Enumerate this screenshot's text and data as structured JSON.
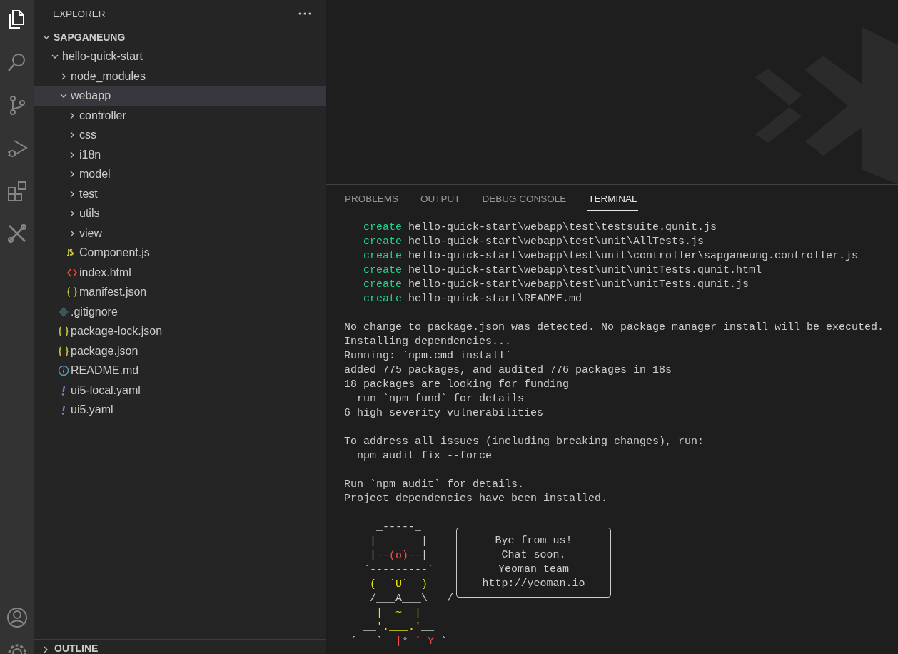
{
  "activity_bar": {
    "items": [
      {
        "kind": "files",
        "selected": true
      },
      {
        "kind": "search",
        "selected": false
      },
      {
        "kind": "source-control",
        "selected": false
      },
      {
        "kind": "run-debug",
        "selected": false
      },
      {
        "kind": "extensions",
        "selected": false
      },
      {
        "kind": "tools",
        "selected": false
      }
    ],
    "bottom_items": [
      {
        "kind": "account",
        "selected": false
      },
      {
        "kind": "settings",
        "selected": false
      }
    ]
  },
  "sidebar": {
    "title": "EXPLORER",
    "tree": {
      "label": "SAPGANEUNG",
      "kind": "folder",
      "expanded": true,
      "selected": false,
      "children": [
        {
          "label": "hello-quick-start",
          "kind": "folder",
          "expanded": true,
          "selected": false,
          "children": [
            {
              "label": "node_modules",
              "kind": "folder",
              "expanded": false,
              "selected": false
            },
            {
              "label": "webapp",
              "kind": "folder",
              "expanded": true,
              "selected": true,
              "children": [
                {
                  "label": "controller",
                  "kind": "folder",
                  "expanded": false,
                  "selected": false
                },
                {
                  "label": "css",
                  "kind": "folder",
                  "expanded": false,
                  "selected": false
                },
                {
                  "label": "i18n",
                  "kind": "folder",
                  "expanded": false,
                  "selected": false
                },
                {
                  "label": "model",
                  "kind": "folder",
                  "expanded": false,
                  "selected": false
                },
                {
                  "label": "test",
                  "kind": "folder",
                  "expanded": false,
                  "selected": false
                },
                {
                  "label": "utils",
                  "kind": "folder",
                  "expanded": false,
                  "selected": false
                },
                {
                  "label": "view",
                  "kind": "folder",
                  "expanded": false,
                  "selected": false
                },
                {
                  "label": "Component.js",
                  "kind": "js",
                  "selected": false
                },
                {
                  "label": "index.html",
                  "kind": "html",
                  "selected": false
                },
                {
                  "label": "manifest.json",
                  "kind": "json",
                  "selected": false
                }
              ]
            },
            {
              "label": ".gitignore",
              "kind": "git",
              "selected": false
            },
            {
              "label": "package-lock.json",
              "kind": "json",
              "selected": false
            },
            {
              "label": "package.json",
              "kind": "json",
              "selected": false
            },
            {
              "label": "README.md",
              "kind": "info",
              "selected": false
            },
            {
              "label": "ui5-local.yaml",
              "kind": "yaml",
              "selected": false
            },
            {
              "label": "ui5.yaml",
              "kind": "yaml",
              "selected": false
            }
          ]
        }
      ]
    },
    "outline": {
      "label": "OUTLINE",
      "expanded": false
    }
  },
  "panel": {
    "tabs": [
      {
        "label": "PROBLEMS",
        "selected": false
      },
      {
        "label": "OUTPUT",
        "selected": false
      },
      {
        "label": "DEBUG CONSOLE",
        "selected": false
      },
      {
        "label": "TERMINAL",
        "selected": true
      }
    ],
    "terminal": {
      "groups": [
        [
          [
            {
              "text": "   create",
              "color": "#23d18b"
            },
            {
              "text": " hello-quick-start\\webapp\\test\\testsuite.qunit.js"
            }
          ],
          [
            {
              "text": "   create",
              "color": "#23d18b"
            },
            {
              "text": " hello-quick-start\\webapp\\test\\unit\\AllTests.js"
            }
          ],
          [
            {
              "text": "   create",
              "color": "#23d18b"
            },
            {
              "text": " hello-quick-start\\webapp\\test\\unit\\controller\\sapganeung.controller.js"
            }
          ],
          [
            {
              "text": "   create",
              "color": "#23d18b"
            },
            {
              "text": " hello-quick-start\\webapp\\test\\unit\\unitTests.qunit.html"
            }
          ],
          [
            {
              "text": "   create",
              "color": "#23d18b"
            },
            {
              "text": " hello-quick-start\\webapp\\test\\unit\\unitTests.qunit.js"
            }
          ],
          [
            {
              "text": "   create",
              "color": "#23d18b"
            },
            {
              "text": " hello-quick-start\\README.md"
            }
          ]
        ],
        [
          [
            {
              "text": "No change to package.json was detected. No package manager install will be executed."
            }
          ],
          [
            {
              "text": "Installing dependencies..."
            }
          ],
          [
            {
              "text": "Running: `npm.cmd install`"
            }
          ],
          [
            {
              "text": "added 775 packages, and audited 776 packages in 18s"
            }
          ],
          [
            {
              "text": "18 packages are looking for funding"
            }
          ],
          [
            {
              "text": "  run `npm fund` for details"
            }
          ],
          [
            {
              "text": "6 high severity vulnerabilities"
            }
          ]
        ],
        [
          [
            {
              "text": "To address all issues (including breaking changes), run:"
            }
          ],
          [
            {
              "text": "  npm audit fix --force"
            }
          ]
        ],
        [
          [
            {
              "text": "Run `npm audit` for details."
            }
          ],
          [
            {
              "text": "Project dependencies have been installed."
            }
          ]
        ]
      ],
      "art": [
        [
          {
            "text": "     _-----_"
          }
        ],
        [
          {
            "text": "    |       |"
          }
        ],
        [
          {
            "text": "    |"
          },
          {
            "text": "--(o)--",
            "color": "#f14c4c"
          },
          {
            "text": "|"
          }
        ],
        [
          {
            "text": "   `---------´"
          }
        ],
        [
          {
            "text": "    ( ",
            "color": "#e5e510"
          },
          {
            "text": "_"
          },
          {
            "text": "´U`",
            "color": "#e5e510"
          },
          {
            "text": "_"
          },
          {
            "text": " )",
            "color": "#e5e510"
          }
        ],
        [
          {
            "text": "    /___A___\\   /"
          }
        ],
        [
          {
            "text": "     |  ~  |",
            "color": "#e5e510"
          }
        ],
        [
          {
            "text": "   __"
          },
          {
            "text": "'.___.'",
            "color": "#e5e510"
          },
          {
            "text": "__"
          }
        ],
        [
          {
            "text": " ´   `  "
          },
          {
            "text": "|",
            "color": "#f14c4c"
          },
          {
            "text": "° "
          },
          {
            "text": "´ Y",
            "color": "#f14c4c"
          },
          {
            "text": " `"
          }
        ]
      ],
      "message_box": [
        "Bye from us!",
        "Chat soon.",
        "Yeoman team",
        "http://yeoman.io"
      ]
    }
  }
}
